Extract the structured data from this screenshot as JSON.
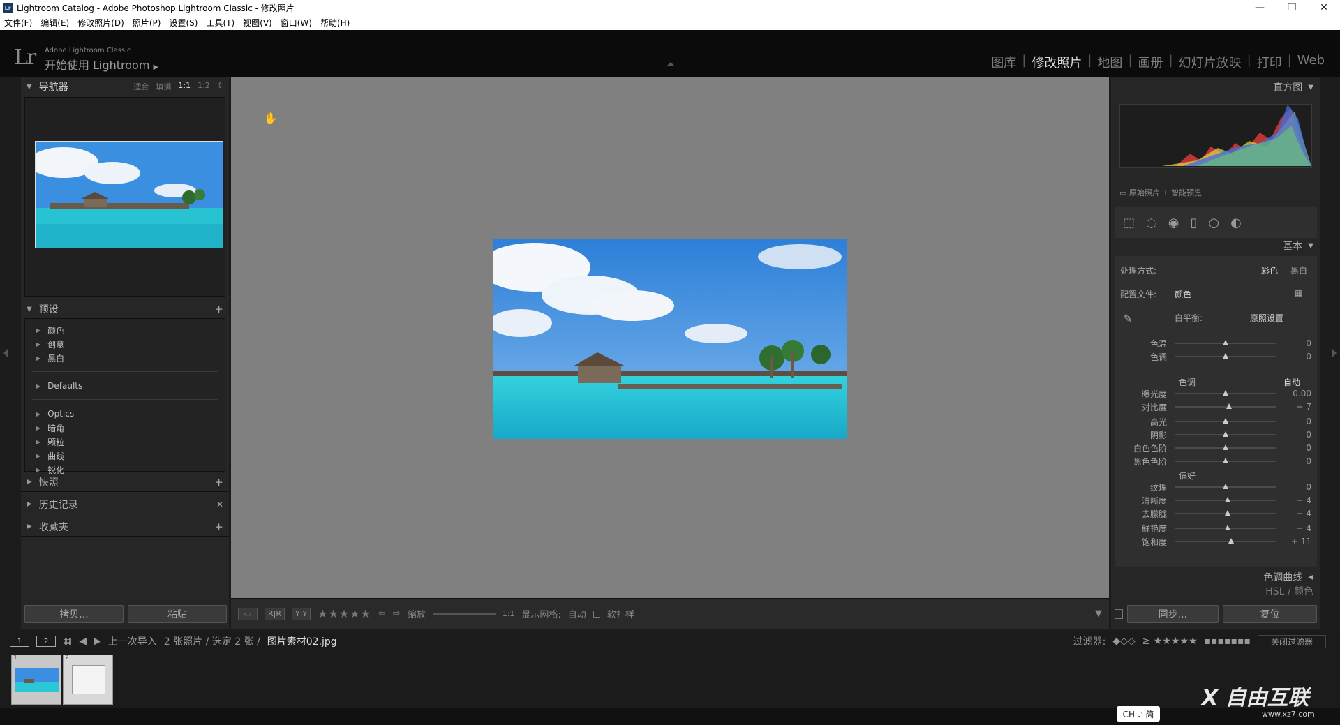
{
  "window": {
    "title": "Lightroom Catalog - Adobe Photoshop Lightroom Classic - 修改照片",
    "app_icon": "Lr"
  },
  "menu": [
    "文件(F)",
    "编辑(E)",
    "修改照片(D)",
    "照片(P)",
    "设置(S)",
    "工具(T)",
    "视图(V)",
    "窗口(W)",
    "帮助(H)"
  ],
  "identity": {
    "logo": "Lr",
    "small": "Adobe Lightroom Classic",
    "big": "开始使用 Lightroom"
  },
  "modules": [
    {
      "label": "图库",
      "active": false
    },
    {
      "label": "修改照片",
      "active": true
    },
    {
      "label": "地图",
      "active": false
    },
    {
      "label": "画册",
      "active": false
    },
    {
      "label": "幻灯片放映",
      "active": false
    },
    {
      "label": "打印",
      "active": false
    },
    {
      "label": "Web",
      "active": false
    }
  ],
  "navigator": {
    "title": "导航器",
    "opts": [
      "适合",
      "填满",
      "1:1",
      "1:2"
    ]
  },
  "presets": {
    "title": "预设",
    "group1": [
      "颜色",
      "创意",
      "黑白"
    ],
    "group2": [
      "Defaults"
    ],
    "group3": [
      "Optics",
      "暗角",
      "颗粒",
      "曲线",
      "锐化"
    ]
  },
  "left_sections": {
    "snapshots": "快照",
    "history": "历史记录",
    "collections": "收藏夹"
  },
  "left_buttons": {
    "copy": "拷贝...",
    "paste": "粘贴"
  },
  "toolbar": {
    "zoom_label": "缩放",
    "zoom_value": "1:1",
    "grid_label": "显示网格:",
    "grid_value": "自动",
    "softproof": "软打样",
    "stars": "★★★★★"
  },
  "right": {
    "histogram": "直方图",
    "histo_label": "原始照片 + 智能预览",
    "basic": "基本",
    "treatment_label": "处理方式:",
    "treatment_color": "彩色",
    "treatment_bw": "黑白",
    "profile_label": "配置文件:",
    "profile_value": "颜色",
    "wb_label": "白平衡:",
    "wb_value": "原照设置",
    "tone_label": "色调",
    "tone_auto": "自动",
    "presence_label": "偏好",
    "tone_curve": "色调曲线",
    "hsl": "HSL / 颜色",
    "sync": "同步...",
    "reset": "复位",
    "wb_sliders": [
      {
        "label": "色温",
        "value": "0",
        "pos": 0.5
      },
      {
        "label": "色调",
        "value": "0",
        "pos": 0.5
      }
    ],
    "tone_sliders_a": [
      {
        "label": "曝光度",
        "value": "0.00",
        "pos": 0.5
      },
      {
        "label": "对比度",
        "value": "+ 7",
        "pos": 0.535
      }
    ],
    "tone_sliders_b": [
      {
        "label": "高光",
        "value": "0",
        "pos": 0.5
      },
      {
        "label": "阴影",
        "value": "0",
        "pos": 0.5
      },
      {
        "label": "白色色阶",
        "value": "0",
        "pos": 0.5
      },
      {
        "label": "黑色色阶",
        "value": "0",
        "pos": 0.5
      }
    ],
    "presence_sliders_a": [
      {
        "label": "纹理",
        "value": "0",
        "pos": 0.5
      },
      {
        "label": "清晰度",
        "value": "+ 4",
        "pos": 0.52
      },
      {
        "label": "去朦胧",
        "value": "+ 4",
        "pos": 0.52
      }
    ],
    "presence_sliders_b": [
      {
        "label": "鲜艳度",
        "value": "+ 4",
        "pos": 0.52
      },
      {
        "label": "饱和度",
        "value": "+ 11",
        "pos": 0.555
      }
    ]
  },
  "filmstrip": {
    "page1": "1",
    "page2": "2",
    "source": "上一次导入",
    "count": "2 张照片 / 选定 2 张 /",
    "filename": "图片素材02.jpg",
    "filter_label": "过滤器:",
    "filter_value": "关闭过滤器",
    "thumb_nums": [
      "1",
      "2"
    ]
  },
  "ime": "CH ♪ 简",
  "watermark": {
    "main": "X 自由互联",
    "sub": "www.xz7.com"
  },
  "colors": {
    "accent_active": "#d8d8d8",
    "panel_bg": "#262626",
    "canvas_bg": "#808080"
  }
}
